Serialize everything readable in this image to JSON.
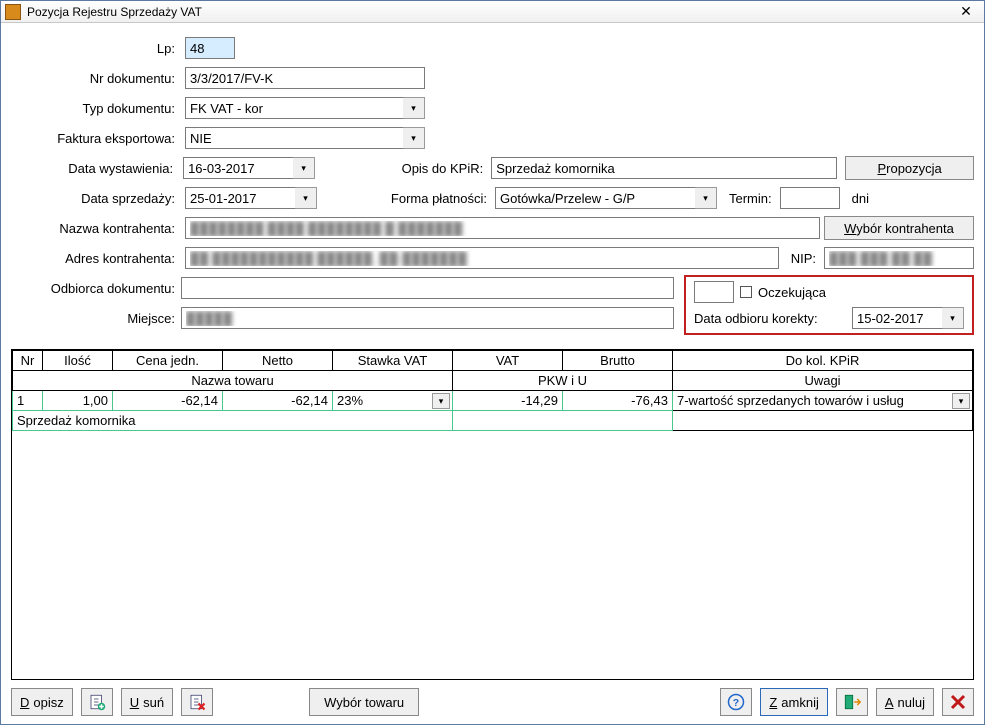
{
  "window": {
    "title": "Pozycja Rejestru Sprzedaży VAT"
  },
  "labels": {
    "lp": "Lp:",
    "nrDok": "Nr dokumentu:",
    "typDok": "Typ dokumentu:",
    "fakturaEksp": "Faktura eksportowa:",
    "dataWyst": "Data wystawienia:",
    "dataSprz": "Data sprzedaży:",
    "opisKpir": "Opis do KPiR:",
    "formaPlat": "Forma płatności:",
    "termin": "Termin:",
    "dni": "dni",
    "nazwaKontr": "Nazwa kontrahenta:",
    "adresKontr": "Adres kontrahenta:",
    "odbiorca": "Odbiorca dokumentu:",
    "miejsce": "Miejsce:",
    "nip": "NIP:",
    "oczekujaca": "Oczekująca",
    "dataOdbioru": "Data odbioru korekty:"
  },
  "values": {
    "lp": "48",
    "nrDok": "3/3/2017/FV-K",
    "typDok": "FK VAT - kor",
    "fakturaEksp": "NIE",
    "dataWyst": "16-03-2017",
    "dataSprz": "25-01-2017",
    "opisKpir": "Sprzedaż komornika",
    "formaPlat": "Gotówka/Przelew - G/P",
    "termin": "",
    "nazwaKontr": "████████ ████ ████████ █ ███████",
    "adresKontr": "██ ███████████ ██████, ██-███████",
    "odbiorca": "",
    "miejsce": "█████",
    "nip": "███ ███ ██ ██",
    "dataOdbioru": "15-02-2017"
  },
  "buttons": {
    "propozycja": "Propozycja",
    "wyborKontr": "Wybór kontrahenta",
    "dopisz": "Dopisz",
    "usun": "Usuń",
    "wyborTowaru": "Wybór towaru",
    "zamknij": "Zamknij",
    "anuluj": "Anuluj"
  },
  "grid": {
    "headers": {
      "nr": "Nr",
      "ilosc": "Ilość",
      "cena": "Cena jedn.",
      "netto": "Netto",
      "stawka": "Stawka VAT",
      "vat": "VAT",
      "brutto": "Brutto",
      "kpir": "Do kol. KPiR",
      "nazwaTowaru": "Nazwa towaru",
      "pkwiu": "PKW i U",
      "uwagi": "Uwagi"
    },
    "row": {
      "nr": "1",
      "ilosc": "1,00",
      "cena": "-62,14",
      "netto": "-62,14",
      "stawka": "23%",
      "vat": "-14,29",
      "brutto": "-76,43",
      "kpir": "7-wartość sprzedanych towarów i usług",
      "nazwaTowaru": "Sprzedaż komornika",
      "pkwiu": "",
      "uwagi": ""
    }
  }
}
